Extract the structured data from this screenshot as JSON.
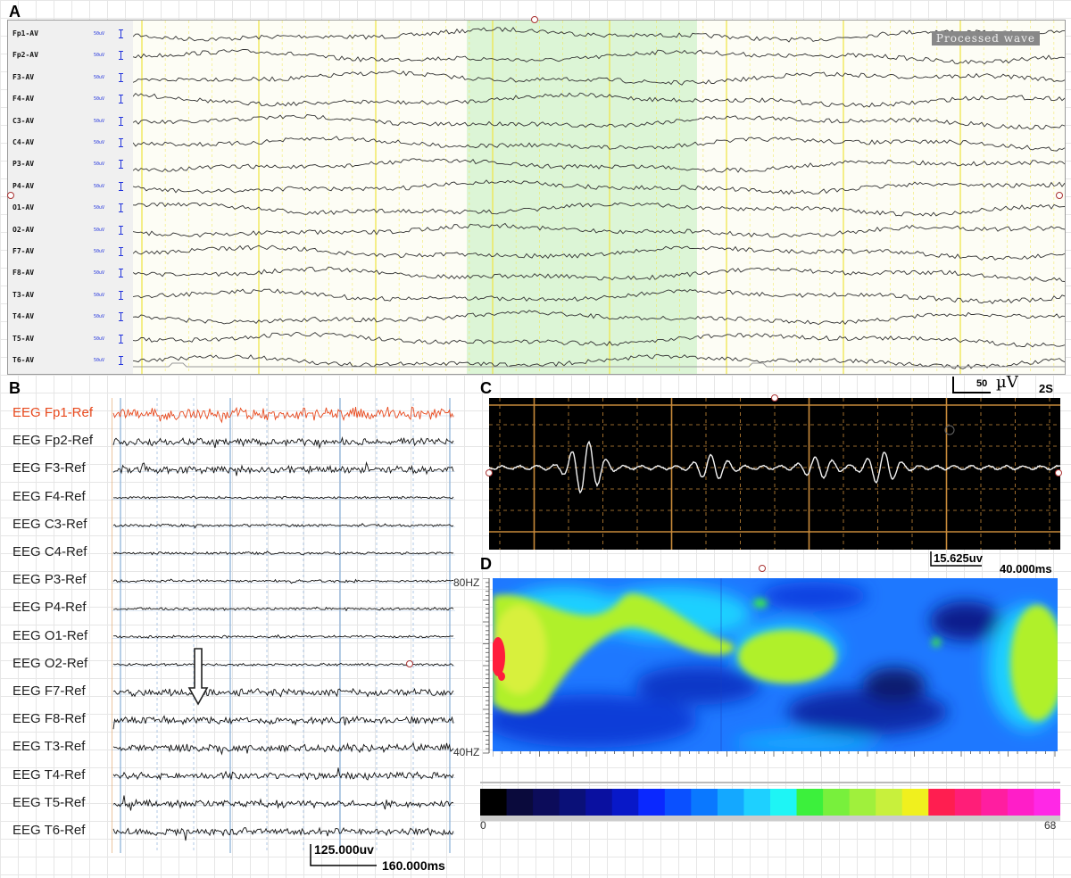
{
  "panels": {
    "a": "A",
    "b": "B",
    "c": "C",
    "d": "D"
  },
  "panelA": {
    "channels": [
      "Fp1-AV",
      "Fp2-AV",
      "F3-AV",
      "F4-AV",
      "C3-AV",
      "C4-AV",
      "P3-AV",
      "P4-AV",
      "O1-AV",
      "O2-AV",
      "F7-AV",
      "F8-AV",
      "T3-AV",
      "T4-AV",
      "T5-AV",
      "T6-AV"
    ],
    "scale_label": "50uV",
    "tag": "Processed wave",
    "colors": {
      "background": "#fdfdf5",
      "highlight": "#dcf5d6",
      "gridline": "#f0e64a",
      "trace": "#333333"
    }
  },
  "panelB": {
    "channels": [
      "EEG Fp1-Ref",
      "EEG Fp2-Ref",
      "EEG F3-Ref",
      "EEG F4-Ref",
      "EEG C3-Ref",
      "EEG C4-Ref",
      "EEG P3-Ref",
      "EEG P4-Ref",
      "EEG O1-Ref",
      "EEG O2-Ref",
      "EEG F7-Ref",
      "EEG F8-Ref",
      "EEG T3-Ref",
      "EEG T4-Ref",
      "EEG T5-Ref",
      "EEG T6-Ref"
    ],
    "highlight_channel": "EEG Fp1-Ref",
    "scale_amplitude": "125.000uv",
    "scale_time": "160.000ms",
    "colors": {
      "highlight": "#e8491d",
      "grid": "#8fb3d9",
      "trace": "#111111"
    }
  },
  "panelC": {
    "amp_unit_value": "50",
    "amp_unit": "µV",
    "duration": "2S",
    "scale_amplitude": "15.625uv",
    "scale_time": "40.000ms",
    "colors": {
      "background": "#000000",
      "grid": "#c88a3a",
      "trace": "#f2f2f2"
    }
  },
  "panelD": {
    "freq_top": "80HZ",
    "freq_bottom": "40HZ",
    "colorbar_min": "0",
    "colorbar_max": "68",
    "colorbar_colors": [
      "#000000",
      "#0a0a3c",
      "#0c0c5a",
      "#0a1078",
      "#0a10a0",
      "#0818c8",
      "#0a28ff",
      "#0a50ff",
      "#0a78ff",
      "#14a8ff",
      "#1ed0ff",
      "#1ef5f5",
      "#3cf03c",
      "#78f03c",
      "#a0f03c",
      "#c8f03c",
      "#f0f01e",
      "#ff1e50",
      "#ff1e78",
      "#ff1ea0",
      "#ff1ec8",
      "#ff28e6"
    ]
  }
}
